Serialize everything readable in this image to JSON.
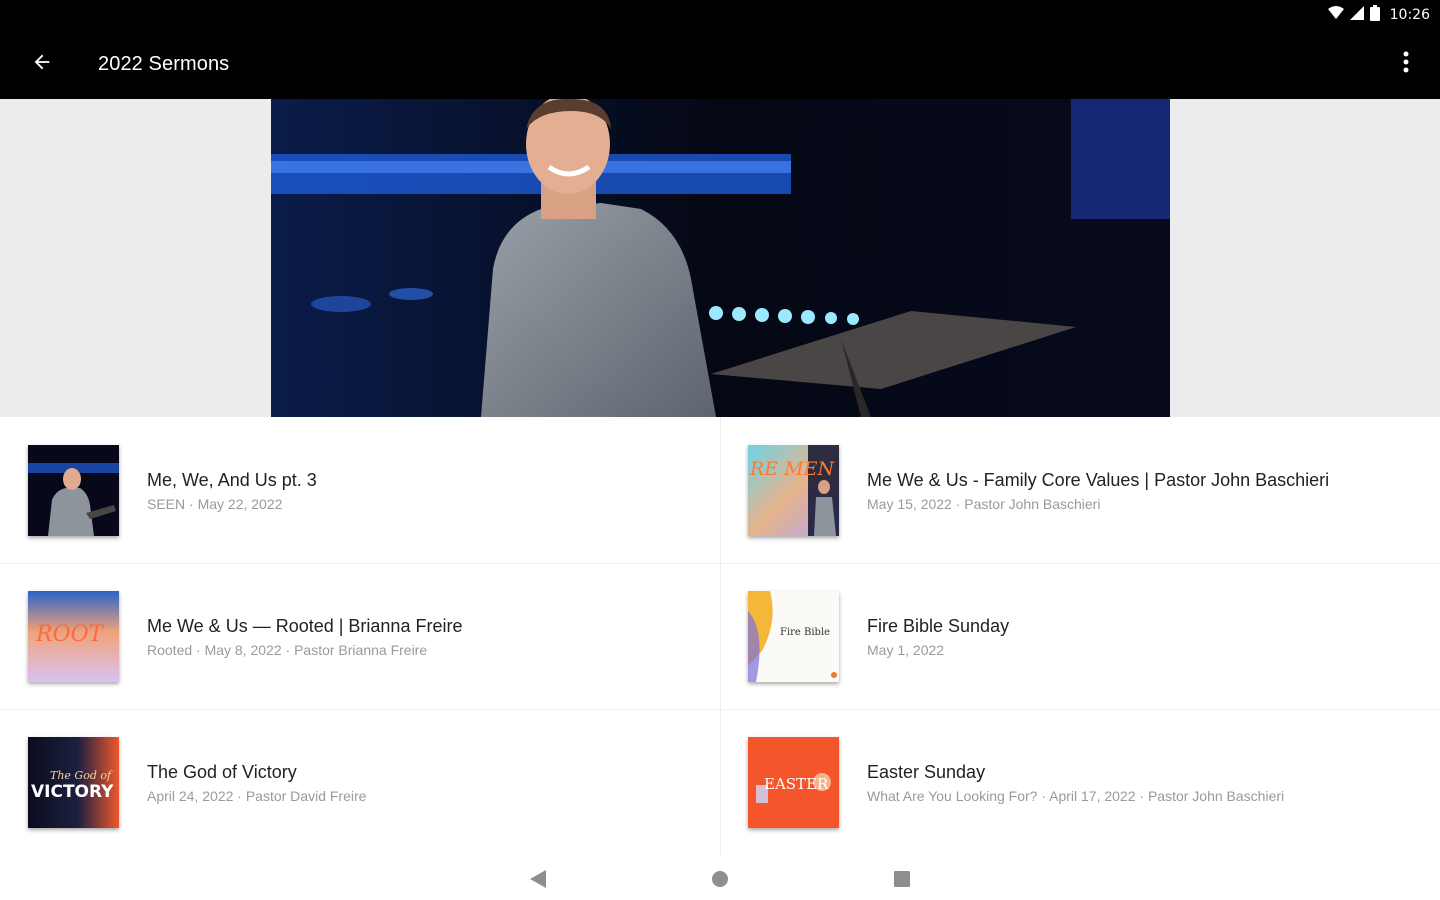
{
  "status_bar": {
    "time": "10:26"
  },
  "app_bar": {
    "title": "2022 Sermons"
  },
  "sermons": [
    {
      "title": "Me, We, And Us pt. 3",
      "subtitle": "SEEN · May 22, 2022"
    },
    {
      "title": "Me We & Us - Family Core Values | Pastor John Baschieri",
      "subtitle": "May 15, 2022 · Pastor John Baschieri"
    },
    {
      "title": "Me We & Us — Rooted |  Brianna Freire",
      "subtitle": "Rooted · May 8, 2022 · Pastor Brianna Freire"
    },
    {
      "title": "Fire Bible Sunday",
      "subtitle": "May 1, 2022"
    },
    {
      "title": "The God of Victory",
      "subtitle": "April 24, 2022 · Pastor David Freire"
    },
    {
      "title": "Easter Sunday",
      "subtitle": "What Are You Looking For? · April 17, 2022 · Pastor John Baschieri"
    }
  ],
  "thumbnails": {
    "t2": "RE MEN US",
    "t3": "ROOT",
    "t4": "Fire Bible",
    "t5a": "The God of",
    "t5b": "VICTORY",
    "t6": "EASTER"
  },
  "icons": {
    "back": "arrow-left-icon",
    "more": "more-vertical-icon",
    "wifi": "wifi-icon",
    "signal": "cell-signal-icon",
    "battery": "battery-icon",
    "nav_back": "triangle-back-icon",
    "nav_home": "circle-home-icon",
    "nav_recents": "square-recents-icon"
  },
  "colors": {
    "app_bar": "#000000",
    "hero_side": "#ececee",
    "easter_orange": "#f4552b"
  }
}
